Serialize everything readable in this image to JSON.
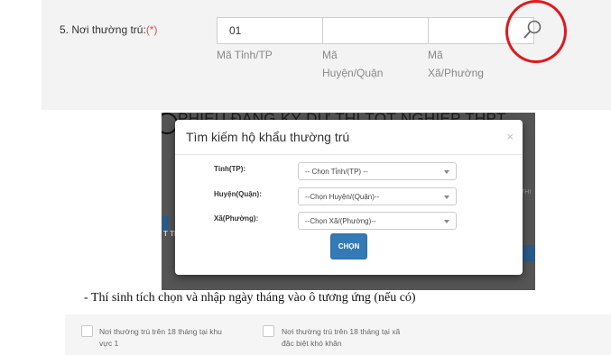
{
  "address_field": {
    "label": "5. Nơi thường trú:",
    "required_mark": "(*)",
    "province_code": "01",
    "district_code": "",
    "ward_code": "",
    "province_caption": "Mã Tỉnh/TP",
    "district_caption_line1": "Mã",
    "district_caption_line2": "Huyện/Quận",
    "ward_caption_line1": "Mã",
    "ward_caption_line2": "Xã/Phường",
    "search_icon": "magnifier-icon",
    "highlight_color": "#e0191d"
  },
  "background_page": {
    "heading": "PHIẾU ĐĂNG KÝ DỰ THI TỐT NGHIỆP THPT",
    "side_fragment_right": "THI",
    "side_fragment_left": "T TH"
  },
  "modal": {
    "title": "Tìm kiếm hộ khẩu thường trú",
    "close": "×",
    "province_label": "Tỉnh(TP):",
    "province_value": "-- Chọn Tỉnh/(TP) --",
    "district_label": "Huyện(Quận):",
    "district_value": "--Chọn Huyện/(Quận)--",
    "ward_label": "Xã(Phường):",
    "ward_value": "--Chọn Xã/(Phường)--",
    "submit_label": "CHỌN",
    "button_color": "#337ab7"
  },
  "instruction": "- Thí sinh tích chọn và nhập ngày tháng vào ô tương ứng (nếu có)",
  "checkboxes": [
    {
      "line1": "Nơi thường trú trên 18 tháng tại khu",
      "line2": "vực 1",
      "checked": false
    },
    {
      "line1": "Nơi thường trú trên 18 tháng tại xã",
      "line2": "đặc biệt khó khăn",
      "checked": false
    }
  ]
}
